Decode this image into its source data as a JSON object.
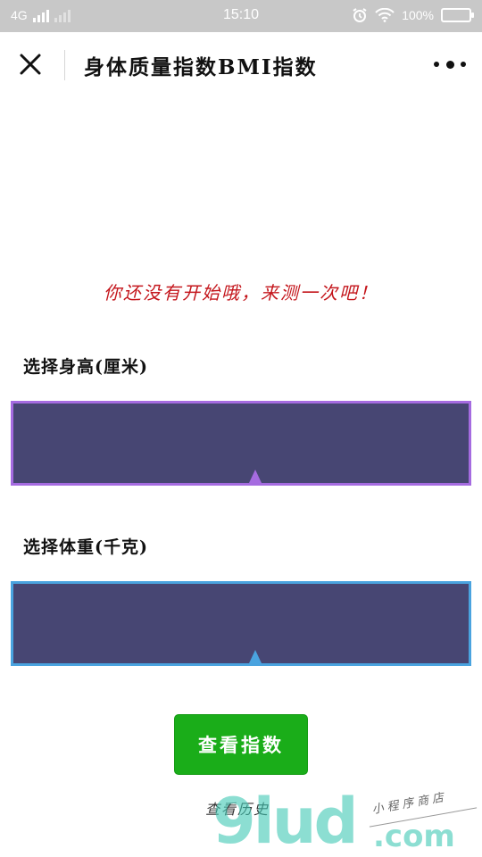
{
  "status_bar": {
    "network": "4G",
    "time": "15:10",
    "battery_percent": "100%",
    "icons": [
      "signal-icon",
      "alarm-icon",
      "wifi-icon",
      "battery-icon"
    ]
  },
  "nav": {
    "title": "身体质量指数BMI指数",
    "icons": [
      "close-icon",
      "more-icon"
    ]
  },
  "main": {
    "hint": "你还没有开始哦，来测一次吧！",
    "height_label": "选择身高(厘米)",
    "weight_label": "选择体重(千克)",
    "view_button": "查看指数",
    "history_link": "查看历史"
  },
  "watermark": {
    "logo": "9lud",
    "suffix": ".com",
    "subtitle": "小程序商店"
  },
  "colors": {
    "hint": "#c4161c",
    "picker_bg": "#474673",
    "height_accent": "#a56be0",
    "weight_accent": "#4aa3df",
    "primary_button": "#1aad19",
    "status_bar": "#c8c8c8"
  }
}
